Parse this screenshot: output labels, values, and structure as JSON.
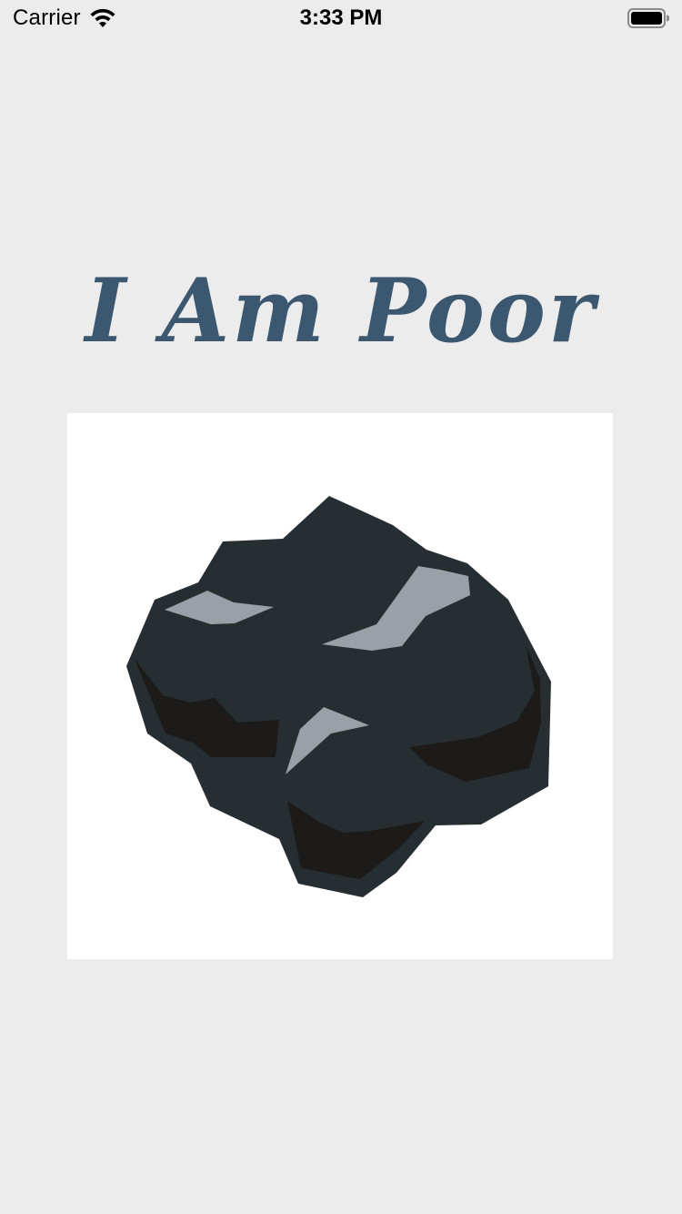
{
  "status_bar": {
    "carrier": "Carrier",
    "time": "3:33 PM",
    "wifi_icon": "wifi-icon",
    "battery_icon": "battery-full-icon"
  },
  "main": {
    "title": "I Am Poor",
    "title_color": "#3c5770",
    "image": {
      "subject": "coal-rock",
      "background_color": "#ffffff"
    }
  },
  "colors": {
    "background": "#ececec",
    "coal_dark": "#262e32",
    "coal_shadow": "#1d1a1a",
    "coal_highlight": "#9aa0a7"
  }
}
